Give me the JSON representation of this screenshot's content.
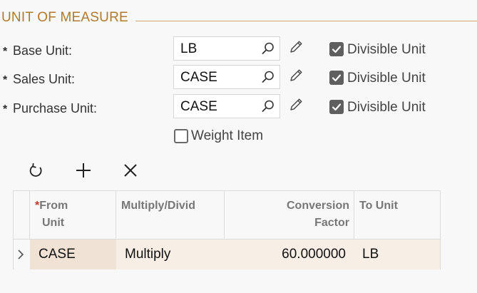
{
  "section": {
    "title": "UNIT OF MEASURE"
  },
  "fields": [
    {
      "label": "Base Unit:",
      "value": "LB",
      "divisible": true,
      "divisible_label": "Divisible Unit"
    },
    {
      "label": "Sales Unit:",
      "value": "CASE",
      "divisible": true,
      "divisible_label": "Divisible Unit"
    },
    {
      "label": "Purchase Unit:",
      "value": "CASE",
      "divisible": true,
      "divisible_label": "Divisible Unit"
    }
  ],
  "required_mark": "*",
  "weight_item": {
    "label": "Weight Item",
    "checked": false
  },
  "toolbar": {
    "icons": [
      "refresh-icon",
      "add-icon",
      "delete-icon"
    ]
  },
  "grid": {
    "columns": [
      {
        "line1": "From",
        "line2": "Unit",
        "required": true
      },
      {
        "line1": "Multiply/Divid",
        "line2": ""
      },
      {
        "line1": "Conversion",
        "line2": "Factor"
      },
      {
        "line1": "To Unit",
        "line2": ""
      }
    ],
    "rows": [
      {
        "from_unit": "CASE",
        "multiply_divide": "Multiply",
        "conversion_factor": "60.000000",
        "to_unit": "LB"
      }
    ]
  },
  "colors": {
    "accent": "#b07a2a",
    "row_highlight": "#f7eee6",
    "required": "#c0392b"
  }
}
